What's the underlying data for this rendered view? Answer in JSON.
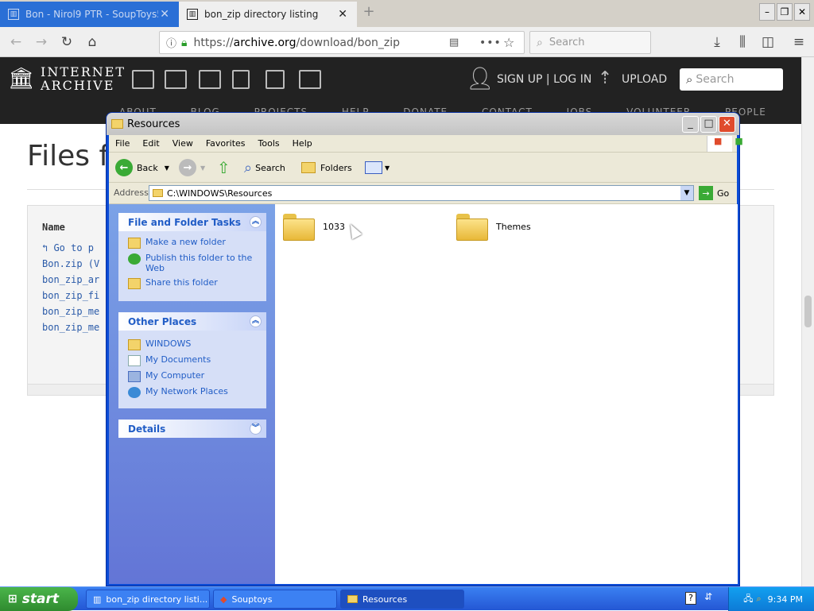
{
  "browser": {
    "tabs": [
      {
        "label": "Bon - Nirol9 PTR - SoupToys5"
      },
      {
        "label": "bon_zip directory listing"
      }
    ],
    "url_prefix": "https://",
    "url_host": "archive.org",
    "url_path": "/download/bon_zip",
    "search_placeholder": "Search"
  },
  "ia": {
    "logo_line1": "INTERNET",
    "logo_line2": "ARCHIVE",
    "signup": "SIGN UP | LOG IN",
    "upload": "UPLOAD",
    "search_placeholder": "Search",
    "menu": "ABOUT BLOG PROJECTS HELP DONATE CONTACT JOBS VOLUNTEER PEOPLE"
  },
  "page": {
    "title": "Files fo",
    "name_header": "Name",
    "files": [
      "Go to p",
      "Bon.zip (V",
      "bon_zip_ar",
      "bon_zip_fi",
      "bon_zip_me",
      "bon_zip_me"
    ]
  },
  "explorer": {
    "title": "Resources",
    "menu": [
      "File",
      "Edit",
      "View",
      "Favorites",
      "Tools",
      "Help"
    ],
    "toolbar": {
      "back": "Back",
      "search": "Search",
      "folders": "Folders"
    },
    "address_label": "Address",
    "address_value": "C:\\WINDOWS\\Resources",
    "go_label": "Go",
    "file_tasks": {
      "title": "File and Folder Tasks",
      "items": [
        "Make a new folder",
        "Publish this folder to the Web",
        "Share this folder"
      ]
    },
    "other_places": {
      "title": "Other Places",
      "items": [
        "WINDOWS",
        "My Documents",
        "My Computer",
        "My Network Places"
      ]
    },
    "details": {
      "title": "Details"
    },
    "folders": [
      "1033",
      "Themes"
    ]
  },
  "taskbar": {
    "start": "start",
    "tasks": [
      "bon_zip directory listi...",
      "Souptoys",
      "Resources"
    ],
    "clock": "9:34 PM"
  }
}
